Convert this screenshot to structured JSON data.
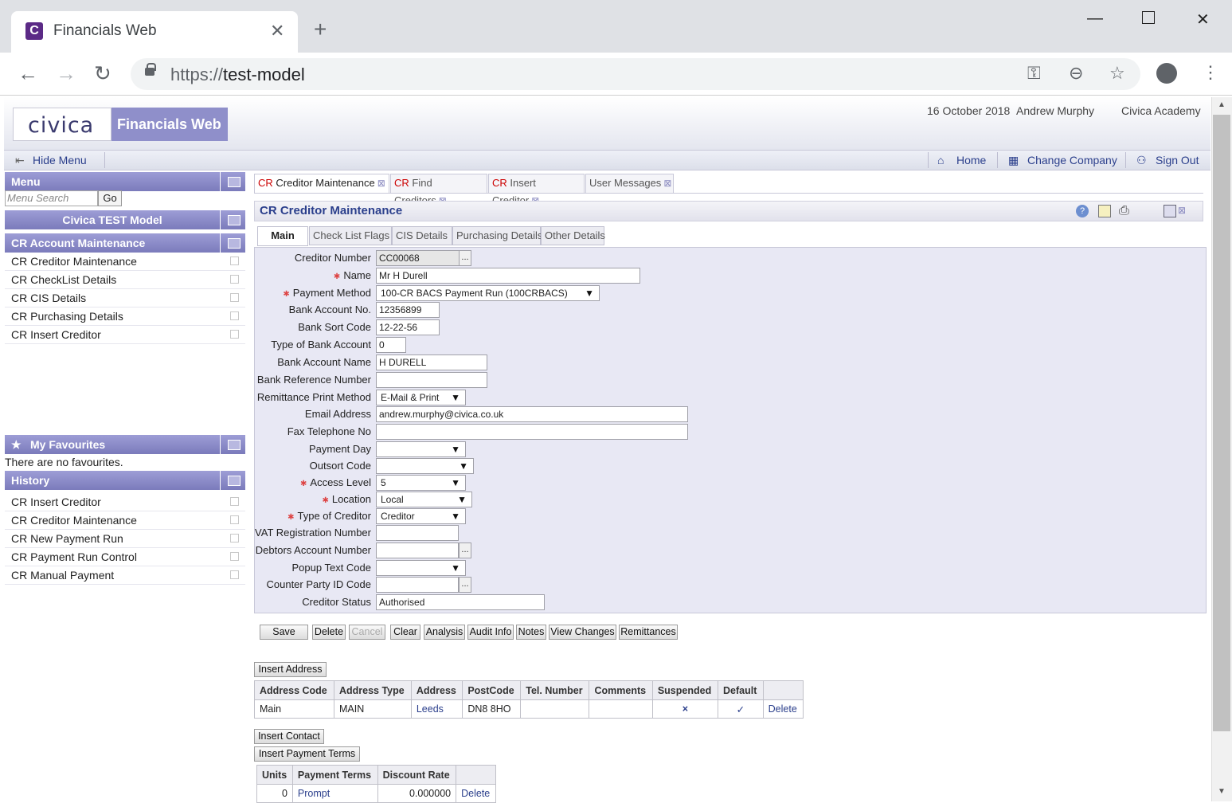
{
  "browser": {
    "tab_title": "Financials Web",
    "favicon_letter": "C",
    "url_scheme": "https://",
    "url_host": "test-model"
  },
  "header": {
    "logo_text": "civica",
    "app_name": "Financials Web",
    "date": "16 October 2018",
    "user": "Andrew Murphy",
    "company": "Civica Academy"
  },
  "menubar": {
    "hide_menu": "Hide Menu",
    "home": "Home",
    "change_company": "Change Company",
    "sign_out": "Sign Out"
  },
  "sidebar": {
    "menu_title": "Menu",
    "search_placeholder": "Menu Search",
    "go_label": "Go",
    "model_title": "Civica TEST Model",
    "section_title": "CR Account Maintenance",
    "items": [
      {
        "label": "CR Creditor Maintenance"
      },
      {
        "label": "CR CheckList Details"
      },
      {
        "label": "CR CIS Details"
      },
      {
        "label": "CR Purchasing Details"
      },
      {
        "label": "CR Insert Creditor"
      }
    ],
    "favourites_title": "My Favourites",
    "favourites_empty": "There are no favourites.",
    "history_title": "History",
    "history": [
      {
        "label": "CR Insert Creditor"
      },
      {
        "label": "CR Creditor Maintenance"
      },
      {
        "label": "CR New Payment Run"
      },
      {
        "label": "CR Payment Run Control"
      },
      {
        "label": "CR Manual Payment"
      }
    ]
  },
  "page_tabs": [
    {
      "prefix": "CR",
      "label": "Creditor Maintenance"
    },
    {
      "prefix": "CR",
      "label": "Find Creditors"
    },
    {
      "prefix": "CR",
      "label": "Insert Creditor"
    },
    {
      "prefix": "",
      "label": "User Messages"
    }
  ],
  "panel_title": "CR Creditor Maintenance",
  "sub_tabs": [
    "Main",
    "Check List Flags",
    "CIS Details",
    "Purchasing Details",
    "Other Details"
  ],
  "form": {
    "creditor_number": {
      "label": "Creditor Number",
      "value": "CC00068"
    },
    "name": {
      "label": "Name",
      "value": "Mr H Durell"
    },
    "payment_method": {
      "label": "Payment Method",
      "value": "100-CR BACS Payment Run (100CRBACS)"
    },
    "bank_account_no": {
      "label": "Bank Account No.",
      "value": "12356899"
    },
    "bank_sort_code": {
      "label": "Bank Sort Code",
      "value": "12-22-56"
    },
    "type_of_bank_account": {
      "label": "Type of Bank Account",
      "value": "0"
    },
    "bank_account_name": {
      "label": "Bank Account Name",
      "value": "H DURELL"
    },
    "bank_reference_number": {
      "label": "Bank Reference Number",
      "value": ""
    },
    "remittance_print_method": {
      "label": "Remittance Print Method",
      "value": "E-Mail & Print"
    },
    "email_address": {
      "label": "Email Address",
      "value": "andrew.murphy@civica.co.uk"
    },
    "fax_telephone_no": {
      "label": "Fax Telephone No",
      "value": ""
    },
    "payment_day": {
      "label": "Payment Day",
      "value": ""
    },
    "outsort_code": {
      "label": "Outsort Code",
      "value": ""
    },
    "access_level": {
      "label": "Access Level",
      "value": "5"
    },
    "location": {
      "label": "Location",
      "value": "Local"
    },
    "type_of_creditor": {
      "label": "Type of Creditor",
      "value": "Creditor"
    },
    "vat_registration_number": {
      "label": "VAT Registration Number",
      "value": ""
    },
    "debtors_account_number": {
      "label": "Debtors Account Number",
      "value": ""
    },
    "popup_text_code": {
      "label": "Popup Text Code",
      "value": ""
    },
    "counter_party_id_code": {
      "label": "Counter Party ID Code",
      "value": ""
    },
    "creditor_status": {
      "label": "Creditor Status",
      "value": "Authorised"
    }
  },
  "lookup_label": "...",
  "actions": {
    "save": "Save",
    "delete": "Delete",
    "cancel": "Cancel",
    "clear": "Clear",
    "analysis": "Analysis",
    "audit_info": "Audit Info",
    "notes": "Notes",
    "view_changes": "View Changes",
    "remittances": "Remittances"
  },
  "address": {
    "insert_label": "Insert Address",
    "headers": [
      "Address Code",
      "Address Type",
      "Address",
      "PostCode",
      "Tel. Number",
      "Comments",
      "Suspended",
      "Default",
      ""
    ],
    "rows": [
      {
        "code": "Main",
        "type": "MAIN",
        "address": "Leeds",
        "postcode": "DN8 8HO",
        "tel": "",
        "comments": "",
        "suspended": "×",
        "default": "✓",
        "action": "Delete"
      }
    ]
  },
  "contact": {
    "insert_label": "Insert Contact"
  },
  "payment_terms": {
    "insert_label": "Insert Payment Terms",
    "headers": [
      "Units",
      "Payment Terms",
      "Discount Rate",
      ""
    ],
    "rows": [
      {
        "units": "0",
        "terms": "Prompt",
        "rate": "0.000000",
        "action": "Delete"
      }
    ]
  }
}
